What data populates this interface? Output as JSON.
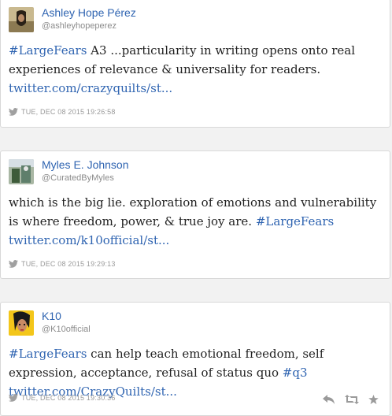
{
  "tweets": [
    {
      "name": "Ashley Hope Pérez",
      "handle": "@ashleyhopeperez",
      "hashtag": "#LargeFears",
      "text": " A3 ...particularity in writing opens onto real experiences of relevance & universality for readers. ",
      "link": "twitter.com/crazyquilts/st...",
      "timestamp": "TUE, DEC 08 2015 19:26:58"
    },
    {
      "name": "Myles E. Johnson",
      "handle": "@CuratedByMyles",
      "text": "which is the big lie. exploration of emotions and vulnerability is where freedom, power, & true joy are. ",
      "hashtag": "#LargeFears",
      "link": "twitter.com/k10official/st...",
      "timestamp": "TUE, DEC 08 2015 19:29:13"
    },
    {
      "name": "K10",
      "handle": "@K10official",
      "hashtag": "#LargeFears",
      "text": " can help teach emotional freedom, self expression, acceptance, refusal of status quo ",
      "hashtag2": "#q3",
      "link": "twitter.com/CrazyQuilts/st...",
      "timestamp": "TUE, DEC 08 2015 19:30:36"
    }
  ],
  "colors": {
    "link": "#2f64b1",
    "meta": "#9a9a9a",
    "border": "#d8d8d8"
  },
  "icons": {
    "twitter": "twitter-bird-icon",
    "reply": "reply-icon",
    "retweet": "retweet-icon",
    "favorite": "star-icon"
  }
}
